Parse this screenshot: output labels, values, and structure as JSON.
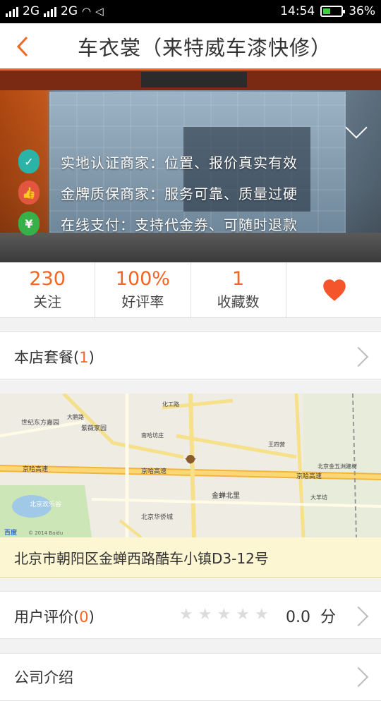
{
  "status_bar": {
    "network1": "2G",
    "network2": "2G",
    "time": "14:54",
    "battery": "36%"
  },
  "header": {
    "title": "车衣裳（来特威车漆快修）"
  },
  "banner": {
    "features": [
      {
        "icon": "location-check-icon",
        "color": "#2bb3a8",
        "text": "实地认证商家：位置、报价真实有效"
      },
      {
        "icon": "thumbs-up-medal-icon",
        "color": "#e2553f",
        "text": "金牌质保商家：服务可靠、质量过硬"
      },
      {
        "icon": "yen-shield-icon",
        "color": "#37b04a",
        "text": "在线支付：支持代金券、可随时退款"
      }
    ]
  },
  "stats": [
    {
      "value": "230",
      "label": "关注"
    },
    {
      "value": "100%",
      "label": "好评率"
    },
    {
      "value": "1",
      "label": "收藏数"
    }
  ],
  "package": {
    "label": "本店套餐",
    "count": "1"
  },
  "map": {
    "labels": {
      "shijidong": "世纪东方嘉园",
      "dongbalu": "大鹏路",
      "ziyuan": "紫薇家园",
      "nanhao": "南哈坊庄",
      "huagong": "化工路",
      "jingha": "京哈高速",
      "jingha2": "京哈高速",
      "jingha3": "京哈高速",
      "beijinghuanle": "北京欢乐谷",
      "jinchan": "金蝉北里",
      "huaqiao": "北京华侨城",
      "wangsi": "王四营",
      "dayangfang": "大羊坊",
      "lianhua": "北京金五洲建材",
      "baidu": "百度",
      "copyright": "© 2014 Baidu"
    }
  },
  "address": "北京市朝阳区金蝉西路酷车小镇D3-12号",
  "reviews": {
    "label": "用户评价",
    "count": "0",
    "score": "0.0",
    "unit": "分",
    "stars": 0
  },
  "company": {
    "label": "公司介绍"
  }
}
